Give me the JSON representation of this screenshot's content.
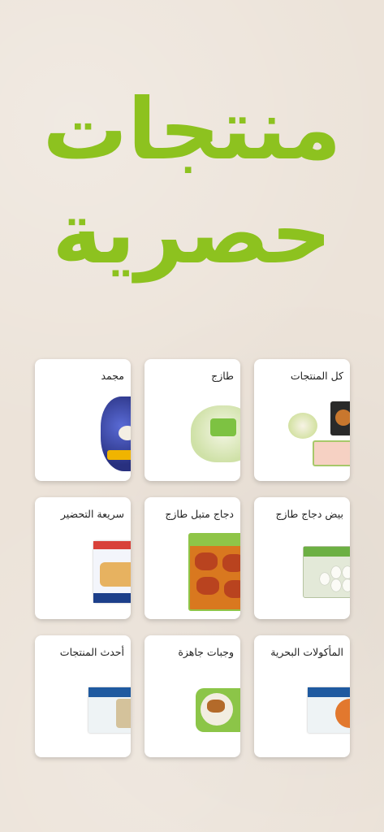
{
  "hero": {
    "line1": "منتجات",
    "line2": "حصرية"
  },
  "colors": {
    "accent": "#8dc21f",
    "background": "#ece3d9",
    "card": "#ffffff"
  },
  "categories": [
    {
      "label": "كل المنتجات",
      "icon": "all-products-icon"
    },
    {
      "label": "طازج",
      "icon": "fresh-chicken-icon"
    },
    {
      "label": "مجمد",
      "icon": "frozen-chicken-icon"
    },
    {
      "label": "بيض دجاج طازج",
      "icon": "egg-box-icon"
    },
    {
      "label": "دجاج متبل طازج",
      "icon": "marinated-chicken-icon"
    },
    {
      "label": "سريعة التحضير",
      "icon": "quick-prep-icon"
    },
    {
      "label": "المأكولات البحرية",
      "icon": "seafood-icon"
    },
    {
      "label": "وجبات جاهزة",
      "icon": "ready-meals-icon"
    },
    {
      "label": "أحدث المنتجات",
      "icon": "newest-products-icon"
    }
  ]
}
